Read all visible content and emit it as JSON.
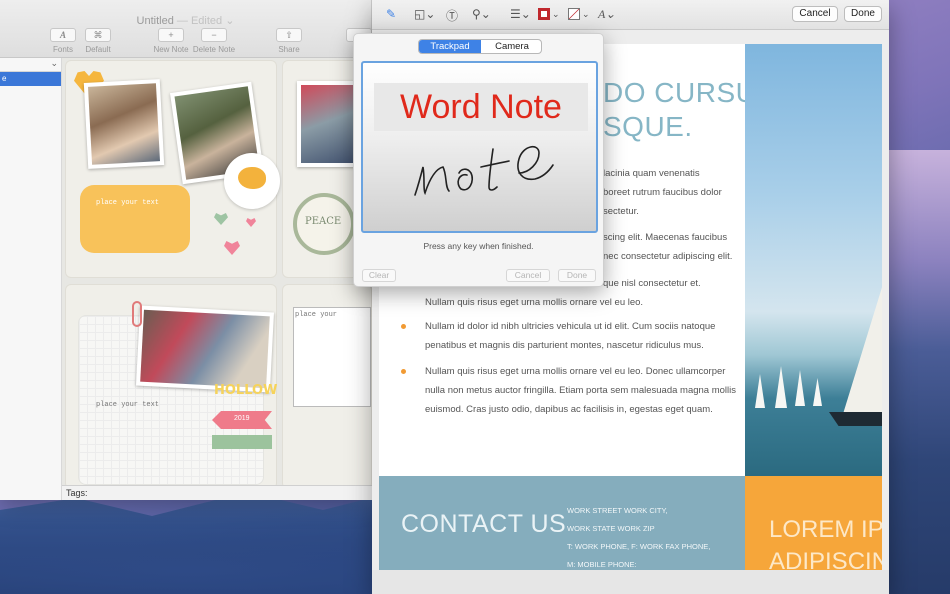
{
  "left_window": {
    "title": "Untitled",
    "title_suffix": "— Edited ⌄",
    "toolbar": {
      "fonts_label": "Fonts",
      "default_label": "Default",
      "new_note_label": "New Note",
      "delete_note_label": "Delete Note",
      "share_label": "Share"
    },
    "sidebar_selected": "e",
    "card_texts": {
      "place_text_1": "place your text",
      "peace": "PEACE",
      "place_text_2": "place your text",
      "place_text_3": "place your",
      "hollow": "HOLLOW",
      "arrow_text": "2019"
    },
    "tags_label": "Tags:"
  },
  "right_window": {
    "cancel_label": "Cancel",
    "done_label": "Done",
    "heading": [
      "DO CURSUS",
      "SQUE."
    ],
    "paragraphs": [
      [
        "lacinia quam venenatis",
        "boreet rutrum faucibus dolor",
        "sectetur."
      ],
      [
        "scing elit. Maecenas faucibus",
        "nec consectetur adipiscing elit."
      ],
      [
        "que nisl consectetur et.",
        "Nullam quis risus eget urna mollis ornare vel eu leo."
      ]
    ],
    "bullets": [
      [
        "Nullam id dolor id nibh ultricies vehicula ut id elit. Cum sociis natoque",
        "penatibus et magnis dis parturient montes, nascetur ridiculus mus."
      ],
      [
        "Nullam quis risus eget urna mollis ornare vel eu leo. Donec ullamcorper",
        "nulla non metus auctor fringilla. Etiam porta sem malesuada magna mollis",
        "euismod. Cras justo odio, dapibus ac facilisis in, egestas eget quam."
      ]
    ],
    "contact_title": "CONTACT US",
    "contact_lines": [
      "WORK STREET WORK CITY,",
      "WORK STATE WORK ZIP",
      "T: WORK PHONE, F: WORK FAX PHONE,",
      "M: MOBILE PHONE:"
    ],
    "orange_text": [
      "LOREM IPSU",
      "ADIPISCING"
    ]
  },
  "signature_popover": {
    "tabs": [
      "Trackpad",
      "Camera"
    ],
    "active_tab": "Trackpad",
    "label": "Word Note",
    "signature": "note",
    "hint": "Press any key when finished.",
    "clear_label": "Clear",
    "cancel_label": "Cancel",
    "done_label": "Done"
  },
  "colors": {
    "accent_blue": "#3e82e6",
    "label_red": "#e0291b",
    "teal_band": "#85adbd",
    "orange_band": "#f6a63a",
    "bullet_orange": "#f19a33"
  }
}
